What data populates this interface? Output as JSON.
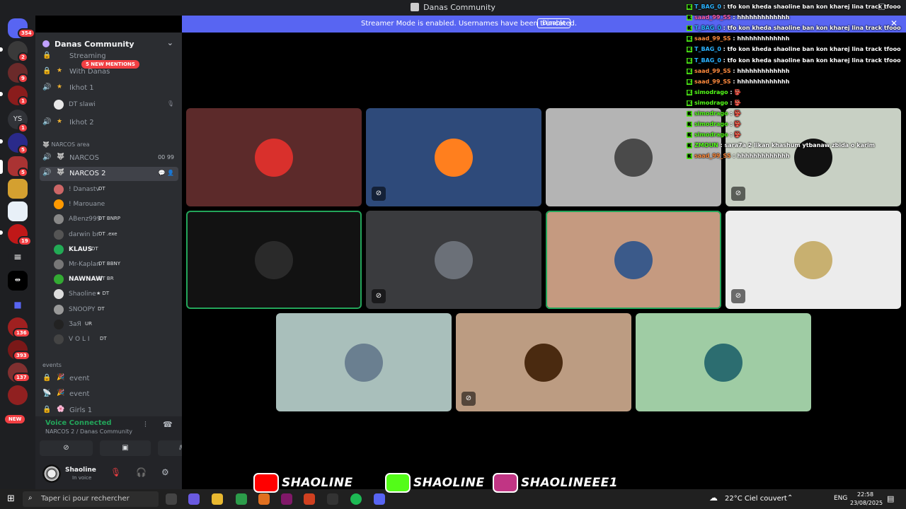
{
  "window": {
    "title": "Danas Community",
    "controls": [
      "—",
      "☐",
      "✕"
    ]
  },
  "streamer_banner": {
    "message": "Streamer Mode is enabled. Usernames have been truncated.",
    "button": "Disable"
  },
  "server": {
    "name": "Danas Community",
    "new_mentions": "5 NEW MENTIONS"
  },
  "rail": {
    "badges": [
      "354",
      "2",
      "9",
      "1",
      "1",
      "5",
      "5",
      "19",
      "136",
      "393",
      "137"
    ],
    "new_label": "NEW",
    "text_server": "YS"
  },
  "channels": {
    "streaming": "Streaming",
    "with_danas": "With Danas",
    "ikhot1": "Ikhot 1",
    "dt_slawi": "DT slawi",
    "ikhot2": "Ikhot 2",
    "narcos_area": "NARCOS area",
    "narcos": "NARCOS",
    "narcos_counts": "00  99",
    "narcos2": "NARCOS 2",
    "events_cat": "events",
    "event1": "event",
    "event2": "event",
    "girls1": "Girls 1"
  },
  "members": [
    {
      "name": "! Danastv",
      "tag": "DT"
    },
    {
      "name": "! Marouane",
      "tag": ""
    },
    {
      "name": "ABenz999",
      "tag": "DT  BNRP"
    },
    {
      "name": "darwin br",
      "tag": "DT  .exe"
    },
    {
      "name": "KLAUS",
      "tag": "DT"
    },
    {
      "name": "Mr-Kaplan",
      "tag": "DT  BBNY"
    },
    {
      "name": "NAWNAW",
      "tag": "DT  BR"
    },
    {
      "name": "Shaoline",
      "tag": "★ DT"
    },
    {
      "name": "SNOOPY",
      "tag": "DT"
    },
    {
      "name": "ƷaЯ",
      "tag": "UR"
    },
    {
      "name": "V O L I",
      "tag": "DT"
    }
  ],
  "voice": {
    "status": "Voice Connected",
    "location": "NARCOS 2 / Danas Community"
  },
  "user": {
    "name": "Shaoline",
    "status": "In voice"
  },
  "chat": [
    {
      "user": "T_BAG_0",
      "color": "#2bb3ff",
      "text": "tfo kon kheda shaoline ban kon kharej lina track tfooo"
    },
    {
      "user": "saad_99_SS",
      "color": "#ff5fb0",
      "text": "hhhhhhhhhhhhh"
    },
    {
      "user": "T_BAG_0",
      "color": "#2bb3ff",
      "text": "tfo kon kheda shaoline ban kon kharej lina track tfooo"
    },
    {
      "user": "saad_99_SS",
      "color": "#ff8a3d",
      "text": "hhhhhhhhhhhhh"
    },
    {
      "user": "T_BAG_0",
      "color": "#2bb3ff",
      "text": "tfo kon kheda shaoline ban kon kharej lina track tfooo"
    },
    {
      "user": "T_BAG_0",
      "color": "#2bb3ff",
      "text": "tfo kon kheda shaoline ban kon kharej lina track tfooo"
    },
    {
      "user": "saad_99_SS",
      "color": "#ff8a3d",
      "text": "hhhhhhhhhhhhh"
    },
    {
      "user": "saad_99_SS",
      "color": "#ff8a3d",
      "text": "hhhhhhhhhhhhh"
    },
    {
      "user": "simodrago",
      "color": "#53fc18",
      "text": "👺"
    },
    {
      "user": "simodrago",
      "color": "#53fc18",
      "text": "👺"
    },
    {
      "user": "simodrago",
      "color": "#53fc18",
      "text": "👺"
    },
    {
      "user": "simodrago",
      "color": "#53fc18",
      "text": "👺"
    },
    {
      "user": "simodrago",
      "color": "#53fc18",
      "text": "👺"
    },
    {
      "user": "ZMOUN",
      "color": "#53fc18",
      "text": "sara7a 2 likan khashum ytbanaw zbida o karim"
    },
    {
      "user": "saad_99_SS",
      "color": "#ff8a3d",
      "text": "hhhhhhhhhhhhh"
    }
  ],
  "tiles": [
    {
      "bg": "#5c2a2a",
      "avatar": "#d9302c",
      "muted": false,
      "speaking": false
    },
    {
      "bg": "#2e4a7a",
      "avatar": "#ff7f1e",
      "muted": true,
      "speaking": false
    },
    {
      "bg": "#b4b4b4",
      "avatar": "#4a4a4a",
      "muted": false,
      "speaking": false
    },
    {
      "bg": "#c8d0c4",
      "avatar": "#111111",
      "muted": true,
      "speaking": false
    },
    {
      "bg": "#121212",
      "avatar": "#2a2a2a",
      "muted": false,
      "speaking": true
    },
    {
      "bg": "#3a3b3e",
      "avatar": "#6b7078",
      "muted": true,
      "speaking": false
    },
    {
      "bg": "#c59a80",
      "avatar": "#3b5a8a",
      "muted": false,
      "speaking": true
    },
    {
      "bg": "#ececec",
      "avatar": "#c8b070",
      "muted": true,
      "speaking": false
    },
    {
      "bg": "#a9bfbb",
      "avatar": "#6a7f90",
      "muted": false,
      "speaking": false
    },
    {
      "bg": "#bc9c82",
      "avatar": "#4a2a10",
      "muted": true,
      "speaking": false
    },
    {
      "bg": "#9fcca4",
      "avatar": "#2c6d70",
      "muted": false,
      "speaking": false
    }
  ],
  "social": [
    {
      "platform": "youtube-icon",
      "color": "#ff0000",
      "handle": "SHAOLINE"
    },
    {
      "platform": "kick-icon",
      "color": "#53fc18",
      "handle": "SHAOLINE"
    },
    {
      "platform": "instagram-icon",
      "color": "#c13584",
      "handle": "SHAOLINEEE1"
    }
  ],
  "taskbar": {
    "search_placeholder": "Taper ici pour rechercher",
    "weather": "22°C  Ciel couvert",
    "lang": "ENG",
    "time": "22:58",
    "date": "23/08/2025"
  }
}
